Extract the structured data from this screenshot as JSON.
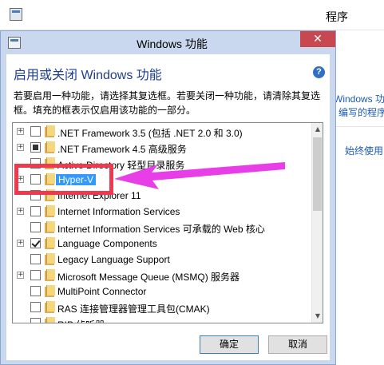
{
  "background_window": {
    "title": "程序",
    "link_1": "Windows 功能",
    "link_2": "编写的程序",
    "link_3": "始终使用"
  },
  "dialog": {
    "title": "Windows 功能",
    "heading": "启用或关闭 Windows 功能",
    "description": "若要启用一种功能，请选择其复选框。若要关闭一种功能，请清除其复选框。填充的框表示仅启用该功能的一部分。",
    "help": "?",
    "close": "✕",
    "ok_label": "确定",
    "cancel_label": "取消"
  },
  "features": [
    {
      "label": ".NET Framework 3.5 (包括 .NET 2.0 和 3.0)",
      "expandable": true,
      "state": "unchecked",
      "selected": false
    },
    {
      "label": ".NET Framework 4.5 高级服务",
      "expandable": true,
      "state": "partial",
      "selected": false
    },
    {
      "label": "Active Directory 轻型目录服务",
      "expandable": false,
      "state": "unchecked",
      "selected": false
    },
    {
      "label": "Hyper-V",
      "expandable": true,
      "state": "unchecked",
      "selected": true
    },
    {
      "label": "Internet Explorer 11",
      "expandable": false,
      "state": "unchecked",
      "selected": false
    },
    {
      "label": "Internet Information Services",
      "expandable": true,
      "state": "unchecked",
      "selected": false
    },
    {
      "label": "Internet Information Services 可承载的 Web 核心",
      "expandable": false,
      "state": "unchecked",
      "selected": false
    },
    {
      "label": "Language Components",
      "expandable": true,
      "state": "checked",
      "selected": false
    },
    {
      "label": "Legacy Language Support",
      "expandable": false,
      "state": "unchecked",
      "selected": false
    },
    {
      "label": "Microsoft Message Queue (MSMQ) 服务器",
      "expandable": true,
      "state": "unchecked",
      "selected": false
    },
    {
      "label": "MultiPoint Connector",
      "expandable": false,
      "state": "unchecked",
      "selected": false
    },
    {
      "label": "RAS 连接管理器管理工具包(CMAK)",
      "expandable": false,
      "state": "unchecked",
      "selected": false
    },
    {
      "label": "RIP 侦听器",
      "expandable": false,
      "state": "unchecked",
      "selected": false
    }
  ],
  "colors": {
    "annotation": "#ee3a4f",
    "arrow": "#e83ee8",
    "selection": "#3399ff",
    "heading": "#1f3e8f"
  }
}
